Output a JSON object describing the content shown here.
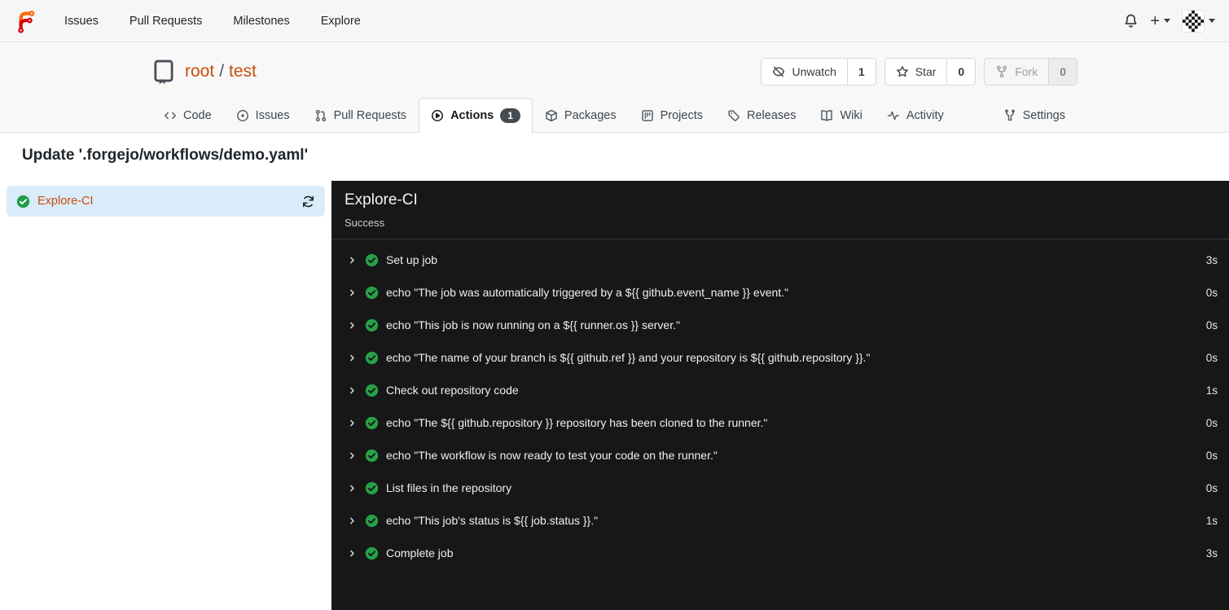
{
  "navbar": {
    "logo": "forgejo-logo",
    "links": [
      "Issues",
      "Pull Requests",
      "Milestones",
      "Explore"
    ],
    "plus_label": "+"
  },
  "repo": {
    "owner": "root",
    "separator": "/",
    "name": "test",
    "action_buttons": [
      {
        "label": "Unwatch",
        "count": "1",
        "icon": "eye-off",
        "disabled": false
      },
      {
        "label": "Star",
        "count": "0",
        "icon": "star",
        "disabled": false
      },
      {
        "label": "Fork",
        "count": "0",
        "icon": "fork",
        "disabled": true
      }
    ],
    "tabs": [
      {
        "label": "Code",
        "icon": "code",
        "active": false
      },
      {
        "label": "Issues",
        "icon": "issue",
        "active": false
      },
      {
        "label": "Pull Requests",
        "icon": "pr",
        "active": false
      },
      {
        "label": "Actions",
        "icon": "play",
        "active": true,
        "badge": "1"
      },
      {
        "label": "Packages",
        "icon": "package",
        "active": false
      },
      {
        "label": "Projects",
        "icon": "project",
        "active": false
      },
      {
        "label": "Releases",
        "icon": "tag",
        "active": false
      },
      {
        "label": "Wiki",
        "icon": "book",
        "active": false
      },
      {
        "label": "Activity",
        "icon": "pulse",
        "active": false
      },
      {
        "label": "Settings",
        "icon": "tools",
        "active": false,
        "right": true
      }
    ]
  },
  "run": {
    "title": "Update '.forgejo/workflows/demo.yaml'",
    "job": {
      "name": "Explore-CI",
      "status": "Success"
    },
    "steps": [
      {
        "name": "Set up job",
        "duration": "3s"
      },
      {
        "name": "echo \"The job was automatically triggered by a ${{ github.event_name }} event.\"",
        "duration": "0s"
      },
      {
        "name": "echo \"This job is now running on a ${{ runner.os }} server.\"",
        "duration": "0s"
      },
      {
        "name": "echo \"The name of your branch is ${{ github.ref }} and your repository is ${{ github.repository }}.\"",
        "duration": "0s"
      },
      {
        "name": "Check out repository code",
        "duration": "1s"
      },
      {
        "name": "echo \"The ${{ github.repository }} repository has been cloned to the runner.\"",
        "duration": "0s"
      },
      {
        "name": "echo \"The workflow is now ready to test your code on the runner.\"",
        "duration": "0s"
      },
      {
        "name": "List files in the repository",
        "duration": "0s"
      },
      {
        "name": "echo \"This job's status is ${{ job.status }}.\"",
        "duration": "1s"
      },
      {
        "name": "Complete job",
        "duration": "3s"
      }
    ]
  },
  "colors": {
    "brand_orange": "#c94d0e",
    "navbar_bg": "#f6f6f6",
    "header_bg": "#f8f8f8",
    "selected_job_bg": "#d9ecf9",
    "success_green_light": "#1e9b49",
    "success_green_dark": "#27a148",
    "panel_bg": "#171717",
    "badge_bg": "#464c52"
  }
}
